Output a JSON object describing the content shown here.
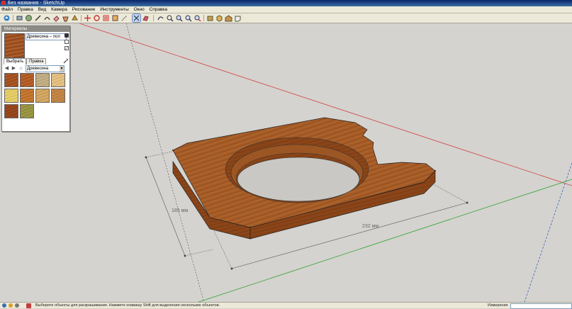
{
  "window": {
    "title": "Без названия - SketchUp"
  },
  "menubar": {
    "items": [
      "Файл",
      "Правка",
      "Вид",
      "Камера",
      "Рисование",
      "Инструменты",
      "Окно",
      "Справка"
    ]
  },
  "toolbar": {
    "icons": [
      "get-started-icon",
      "rectangle-icon",
      "circle-icon",
      "line-icon",
      "arc-icon",
      "eraser-icon",
      "paint-bucket-icon",
      "push-pull-icon",
      "offset-icon",
      "move-icon",
      "rotate-icon",
      "scale-icon",
      "follow-me-icon",
      "tape-measure-icon",
      "dimension-icon",
      "protractor-icon",
      "text-icon",
      "axes-icon",
      "section-plane-icon",
      "orbit-icon",
      "pan-icon",
      "zoom-icon",
      "zoom-window-icon",
      "zoom-extents-icon",
      "position-camera-icon",
      "look-around-icon",
      "walk-icon",
      "add-location-icon",
      "components-icon",
      "3d-warehouse-icon",
      "share-model-icon"
    ]
  },
  "materials_panel": {
    "title": "Материалы",
    "material_name": "Древесина – пол",
    "tabs": [
      "Выбрать",
      "Правка"
    ],
    "selected_tab": "Выбрать",
    "library": "Древесина",
    "swatch_colors": [
      "#9a4a1c",
      "#a8521f",
      "#c8b48a",
      "#d8b475",
      "#dcc35a",
      "#b96b25",
      "#c99a55",
      "#b87c3c",
      "#8c3f17",
      "#8e8a3a"
    ]
  },
  "viewport": {
    "dimension_width": "232 мм",
    "dimension_depth": "185 мм",
    "axis_colors": {
      "red": "#d24040",
      "green": "#30a030",
      "blue": "#4060c0"
    },
    "model_color": "#a65c27"
  },
  "statusbar": {
    "hint": "Выберите объекты для раскрашивания. Нажмите клавишу Shift для выделения нескольких объектов.",
    "measurements_label": "Измерения"
  }
}
